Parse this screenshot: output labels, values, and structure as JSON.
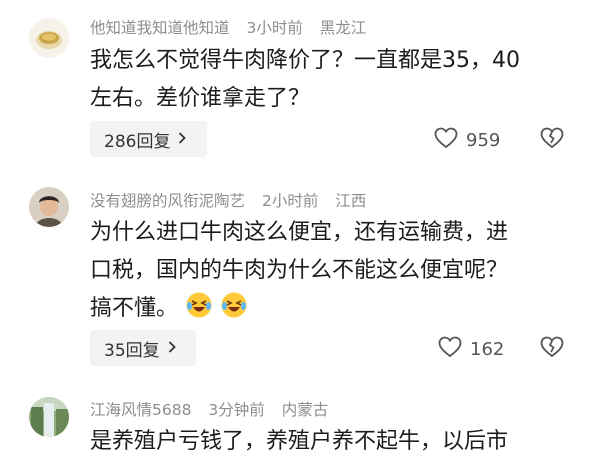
{
  "comments": [
    {
      "username": "他知道我知道他知道",
      "time": "3小时前",
      "location": "黑龙江",
      "text_lines": [
        "我怎么不觉得牛肉降价了？一直都是35，40",
        "左右。差价谁拿走了？"
      ],
      "reply_label": "286回复",
      "likes": "959"
    },
    {
      "username": "没有翅膀的风衔泥陶艺",
      "time": "2小时前",
      "location": "江西",
      "text_lines": [
        "为什么进口牛肉这么便宜，还有运输费，进",
        "口税，国内的牛肉为什么不能这么便宜呢？",
        "搞不懂。"
      ],
      "reply_label": "35回复",
      "likes": "162"
    },
    {
      "username": "江海风情5688",
      "time": "3分钟前",
      "location": "内蒙古",
      "text_lines": [
        "是养殖户亏钱了，养殖户养不起牛，以后市"
      ]
    }
  ],
  "icons": {
    "like": "heart-outline-icon",
    "dislike": "broken-heart-icon",
    "emoji": "laughing-crying-emoji-icon",
    "chevron": "chevron-right-icon"
  },
  "colors": {
    "meta_gray": "#8e8e8e",
    "button_bg": "#f3f3f3",
    "text": "#1c1c1c"
  }
}
